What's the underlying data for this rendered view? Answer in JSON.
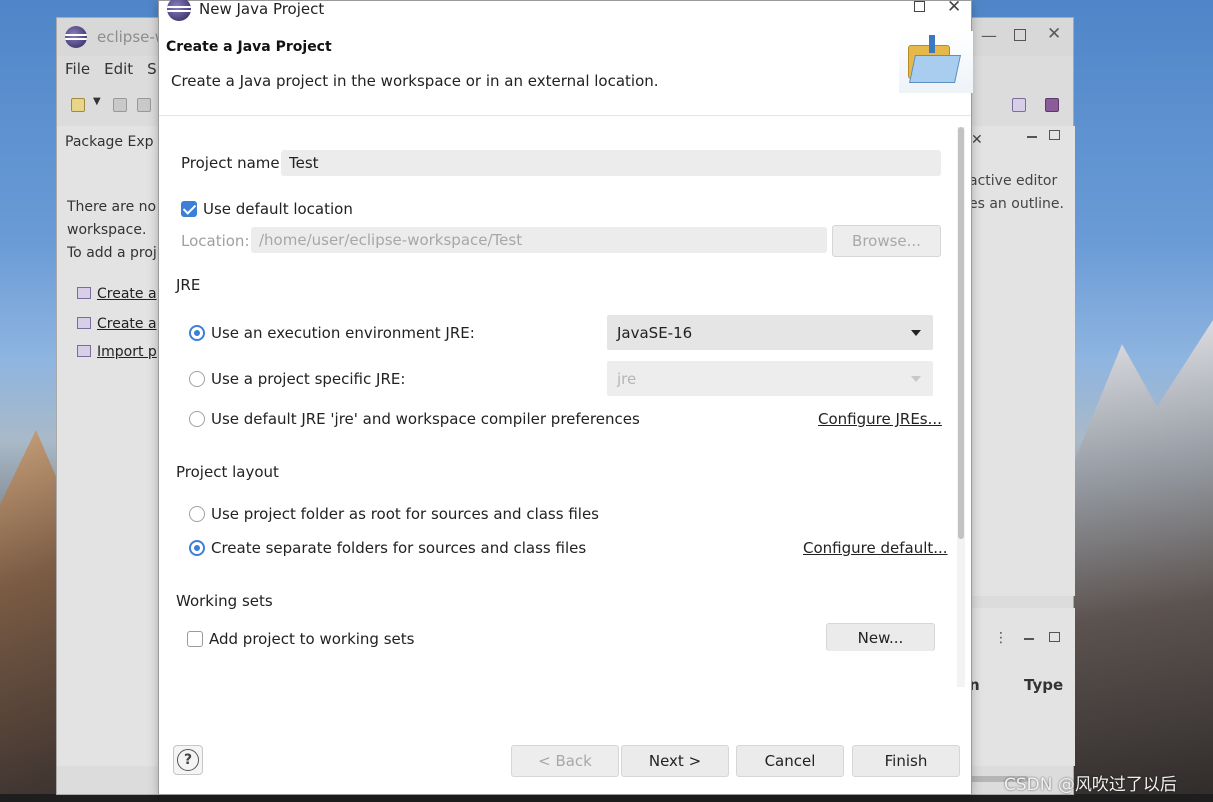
{
  "background_window": {
    "title": "eclipse-w",
    "menu": [
      "File",
      "Edit",
      "S"
    ],
    "package_explorer_tab": "Package Exp",
    "package_message_lines": [
      "There are no p",
      "workspace.",
      "To add a proj"
    ],
    "package_links": [
      "Create a",
      "Create a",
      "Import p"
    ],
    "outline_lines": [
      "active editor",
      "es an outline."
    ],
    "bottom_panel": {
      "col_n": "n",
      "col_type": "Type"
    }
  },
  "dialog": {
    "title": "New Java Project",
    "banner_title": "Create a Java Project",
    "banner_description": "Create a Java project in the workspace or in an external location.",
    "project_name_label": "Project name:",
    "project_name_value": "Test",
    "use_default_location_label": "Use default location",
    "use_default_location_checked": true,
    "location_label": "Location:",
    "location_value": "/home/user/eclipse-workspace/Test",
    "browse_button": "Browse...",
    "jre_section": "JRE",
    "jre_options": [
      {
        "label": "Use an execution environment JRE:",
        "selected": true
      },
      {
        "label": "Use a project specific JRE:",
        "selected": false
      },
      {
        "label": "Use default JRE 'jre' and workspace compiler preferences",
        "selected": false
      }
    ],
    "exec_env_value": "JavaSE-16",
    "project_jre_value": "jre",
    "configure_jres_link": "Configure JREs...",
    "layout_section": "Project layout",
    "layout_options": [
      {
        "label": "Use project folder as root for sources and class files",
        "selected": false
      },
      {
        "label": "Create separate folders for sources and class files",
        "selected": true
      }
    ],
    "configure_default_link": "Configure default...",
    "working_sets_section": "Working sets",
    "add_to_working_sets_label": "Add project to working sets",
    "add_to_working_sets_checked": false,
    "new_button": "New...",
    "help_symbol": "?",
    "back_button": "< Back",
    "next_button": "Next >",
    "cancel_button": "Cancel",
    "finish_button": "Finish"
  },
  "watermark": "CSDN @风吹过了以后",
  "colors": {
    "accent": "#3c7fd6",
    "dialog_bg": "#ffffff",
    "input_bg": "#ececec"
  }
}
